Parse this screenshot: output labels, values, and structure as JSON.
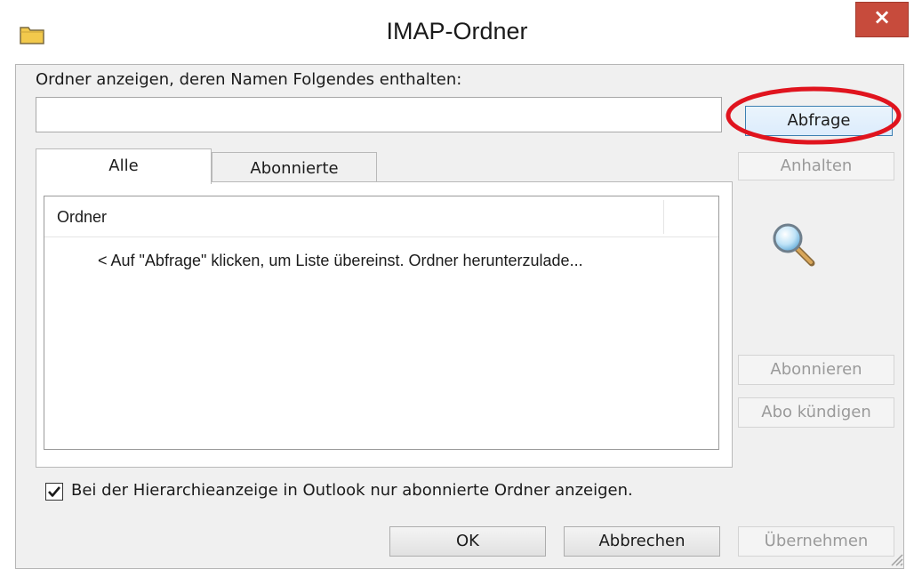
{
  "window": {
    "title": "IMAP-Ordner",
    "close_label": "×"
  },
  "filter": {
    "label": "Ordner anzeigen, deren Namen Folgendes enthalten:",
    "value": ""
  },
  "buttons": {
    "query": "Abfrage",
    "stop": "Anhalten",
    "subscribe": "Abonnieren",
    "unsubscribe": "Abo kündigen",
    "ok": "OK",
    "cancel": "Abbrechen",
    "apply": "Übernehmen"
  },
  "tabs": [
    {
      "label": "Alle",
      "active": true
    },
    {
      "label": "Abonnierte",
      "active": false
    }
  ],
  "list": {
    "column_header": "Ordner",
    "hint": "< Auf \"Abfrage\" klicken, um Liste übereinst. Ordner herunterzulade..."
  },
  "option": {
    "label": "Bei der Hierarchieanzeige in Outlook nur abonnierte Ordner anzeigen.",
    "checked": true
  },
  "icons": {
    "app": "folder-icon",
    "search": "magnifier-icon",
    "close": "close-icon",
    "grip": "resize-grip-icon"
  },
  "colors": {
    "close_button": "#c74b3c",
    "highlight_ellipse": "#e0141e",
    "default_button_border": "#3c7fb1"
  }
}
